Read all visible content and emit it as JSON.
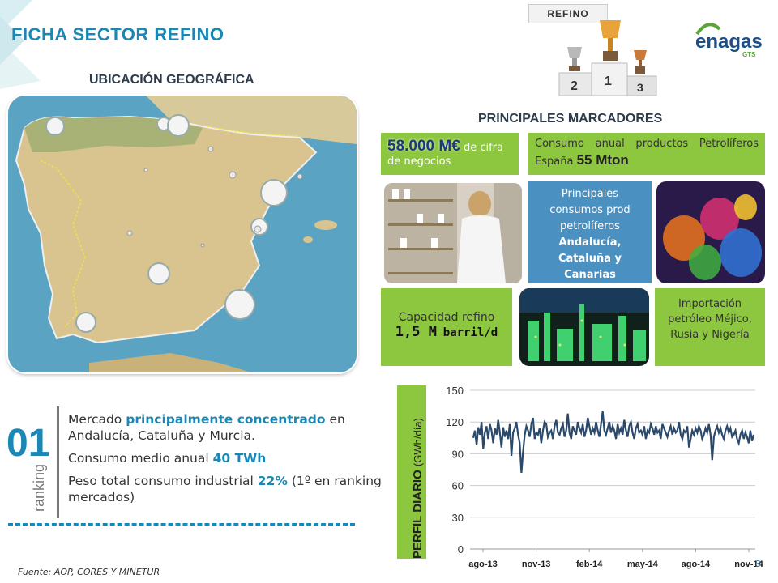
{
  "header": {
    "title": "FICHA SECTOR REFINO",
    "tag": "REFINO",
    "logo": "enagas",
    "logo_sub": "GTS",
    "podium_numbers": [
      "2",
      "1",
      "3"
    ]
  },
  "map": {
    "title": "UBICACIÓN GEOGRÁFICA"
  },
  "markers": {
    "title": "PRINCIPALES MARCADORES",
    "revenue_value": "58.000 M€",
    "revenue_text": "de cifra de negocios",
    "consumption_text": "Consumo anual productos Petrolíferos España",
    "consumption_value": "55 Mton",
    "main_consumers_intro": "Principales consumos prod petrolíferos",
    "main_consumers_regions": "Andalucía, Cataluña y Canarias",
    "capacity_label": "Capacidad refino",
    "capacity_value": "1,5 M",
    "capacity_unit": "barril/d",
    "imports_text": "Importación petróleo Méjico, Rusia y Nigería"
  },
  "ranking": {
    "number": "01",
    "word": "ranking",
    "bullet1_pre": "Mercado ",
    "bullet1_hl": "principalmente concentrado",
    "bullet1_post": " en Andalucía, Cataluña y Murcia.",
    "bullet2_pre": "Consumo medio anual ",
    "bullet2_hl": "40 TWh",
    "bullet3_pre": "Peso total consumo industrial ",
    "bullet3_hl": "22%",
    "bullet3_post": " (1º en ranking mercados)"
  },
  "footer": {
    "source": "Fuente: AOP, CORES Y MINETUR",
    "page": "3"
  },
  "chart_side": {
    "label": "PERFIL DIARIO",
    "unit": "(GWh/día)"
  },
  "colors": {
    "accent_blue": "#1a87b5",
    "green": "#8dc63f",
    "box_blue": "#4a90c0",
    "line": "#2b4a6b"
  },
  "chart_data": {
    "type": "line",
    "ylim": [
      0,
      150
    ],
    "yticks": [
      "0",
      "30",
      "60",
      "90",
      "120",
      "150"
    ],
    "xticks": [
      "ago-13",
      "nov-13",
      "feb-14",
      "may-14",
      "ago-14",
      "nov-14"
    ],
    "series": [
      {
        "values": [
          105,
          112,
          98,
          115,
          108,
          120,
          95,
          110,
          116,
          104,
          118,
          112,
          100,
          114,
          108,
          122,
          110,
          96,
          115,
          106,
          112,
          104,
          118,
          88,
          110,
          114,
          120,
          108,
          100,
          72,
          92,
          108,
          116,
          112,
          106,
          118,
          124,
          104,
          110,
          108,
          114,
          100,
          112,
          120,
          118,
          106,
          110,
          112,
          104,
          116,
          122,
          110,
          108,
          114,
          118,
          106,
          112,
          128,
          110,
          104,
          116,
          112,
          108,
          120,
          114,
          110,
          118,
          106,
          112,
          124,
          116,
          108,
          114,
          110,
          120,
          112,
          106,
          118,
          130,
          112,
          108,
          114,
          120,
          110,
          116,
          112,
          104,
          118,
          110,
          114,
          108,
          122,
          112,
          106,
          116,
          120,
          110,
          104,
          114,
          118,
          110,
          112,
          108,
          116,
          104,
          112,
          110,
          118,
          114,
          108,
          116,
          110,
          112,
          104,
          118,
          114,
          110,
          106,
          112,
          116,
          108,
          114,
          110,
          112,
          120,
          108,
          104,
          112,
          110,
          116,
          96,
          104,
          112,
          108,
          114,
          110,
          116,
          112,
          104,
          108,
          114,
          110,
          118,
          108,
          84,
          106,
          112,
          116,
          110,
          114,
          108,
          104,
          112,
          116,
          110,
          114,
          106,
          108,
          112,
          104,
          100,
          108,
          112,
          104,
          110,
          106,
          100,
          112,
          102,
          108
        ]
      }
    ]
  }
}
